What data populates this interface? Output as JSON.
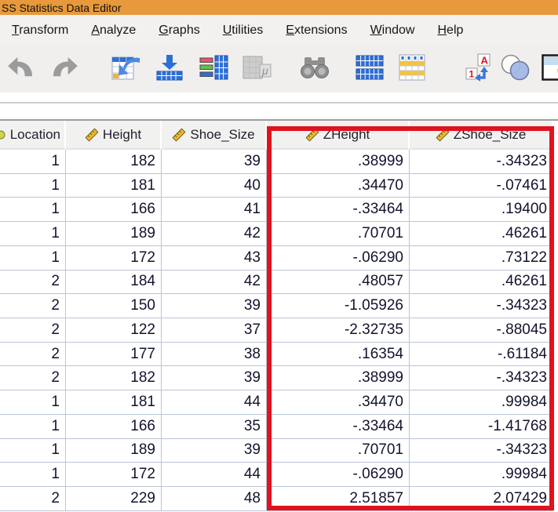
{
  "window": {
    "title": "SS Statistics Data Editor"
  },
  "menu": {
    "items": [
      "Transform",
      "Analyze",
      "Graphs",
      "Utilities",
      "Extensions",
      "Window",
      "Help"
    ]
  },
  "toolbar": {
    "icons": [
      "undo",
      "redo",
      "goto-case",
      "goto-variable",
      "variables",
      "descriptive-statistics",
      "find",
      "split-file",
      "select-cases",
      "value-labels",
      "use-variable-sets",
      "chart-partial"
    ]
  },
  "table": {
    "columns": [
      {
        "name": "Location",
        "measure_icon": "nominal-partial"
      },
      {
        "name": "Height",
        "measure_icon": "scale-ruler"
      },
      {
        "name": "Shoe_Size",
        "measure_icon": "scale-ruler"
      },
      {
        "name": "ZHeight",
        "measure_icon": "scale-ruler"
      },
      {
        "name": "ZShoe_Size",
        "measure_icon": "scale-ruler"
      }
    ],
    "rows": [
      [
        "1",
        "182",
        "39",
        ".38999",
        "-.34323"
      ],
      [
        "1",
        "181",
        "40",
        ".34470",
        "-.07461"
      ],
      [
        "1",
        "166",
        "41",
        "-.33464",
        ".19400"
      ],
      [
        "1",
        "189",
        "42",
        ".70701",
        ".46261"
      ],
      [
        "1",
        "172",
        "43",
        "-.06290",
        ".73122"
      ],
      [
        "2",
        "184",
        "42",
        ".48057",
        ".46261"
      ],
      [
        "2",
        "150",
        "39",
        "-1.05926",
        "-.34323"
      ],
      [
        "2",
        "122",
        "37",
        "-2.32735",
        "-.88045"
      ],
      [
        "2",
        "177",
        "38",
        ".16354",
        "-.61184"
      ],
      [
        "2",
        "182",
        "39",
        ".38999",
        "-.34323"
      ],
      [
        "1",
        "181",
        "44",
        ".34470",
        ".99984"
      ],
      [
        "1",
        "166",
        "35",
        "-.33464",
        "-1.41768"
      ],
      [
        "1",
        "189",
        "39",
        ".70701",
        "-.34323"
      ],
      [
        "1",
        "172",
        "44",
        "-.06290",
        ".99984"
      ],
      [
        "2",
        "229",
        "48",
        "2.51857",
        "2.07429"
      ]
    ]
  },
  "highlight": {
    "color": "#E0121E",
    "columns": [
      "ZHeight",
      "ZShoe_Size"
    ]
  },
  "colors": {
    "titlebar_orange": "#E8993B",
    "toolbar_blue": "#2E6FD6",
    "ruler_gold": "#EDB92E",
    "grid_line": "#BCC5D6"
  }
}
